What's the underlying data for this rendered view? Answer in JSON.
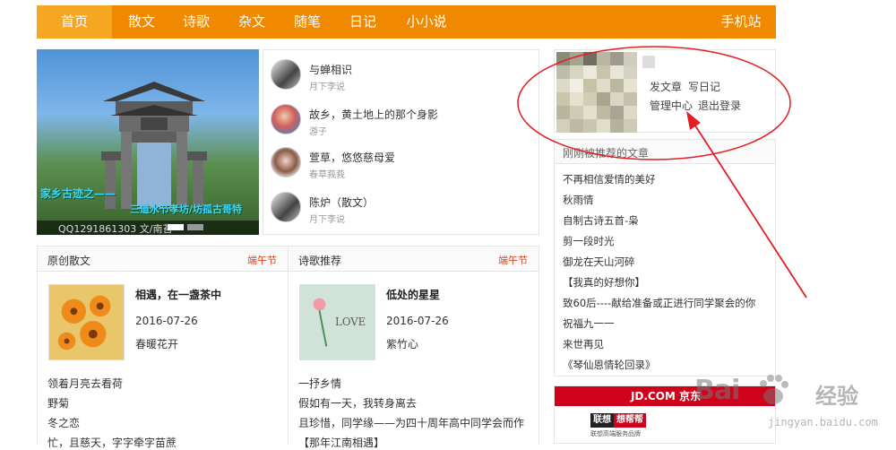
{
  "nav": {
    "items": [
      {
        "label": "首页",
        "active": true
      },
      {
        "label": "散文"
      },
      {
        "label": "诗歌"
      },
      {
        "label": "杂文"
      },
      {
        "label": "随笔"
      },
      {
        "label": "日记"
      },
      {
        "label": "小小说"
      }
    ],
    "mobile_label": "手机站",
    "color": "#f08800"
  },
  "slider": {
    "text_line1": "家乡古迹之——",
    "text_line2": "三道水节孝坊/坊孤古哥特",
    "caption": "QQ1291861303  文/南苔"
  },
  "featured": [
    {
      "title": "与蝉相识",
      "author": "月下李说"
    },
    {
      "title": "故乡，黄土地上的那个身影",
      "author": "游子"
    },
    {
      "title": "萱草，悠悠慈母爱",
      "author": "春草莪莪"
    },
    {
      "title": "陈炉（散文）",
      "author": "月下李说"
    }
  ],
  "prose": {
    "title": "原创散文",
    "tag": "端午节",
    "top": {
      "title": "相遇，在一盏茶中",
      "date": "2016-07-26",
      "author": "春暖花开"
    },
    "list": [
      "领着月亮去看荷",
      "野菊",
      "冬之恋",
      "忙，且慈天，字字牵字苗蔗"
    ]
  },
  "poetry": {
    "title": "诗歌推荐",
    "tag": "端午节",
    "top": {
      "title": "低处的星星",
      "date": "2016-07-26",
      "author": "紫竹心"
    },
    "list": [
      "一抒乡情",
      "假如有一天，我转身离去",
      "且珍惜，同学缘——为四十周年高中同学会而作",
      "【那年江南相遇】"
    ]
  },
  "user": {
    "post_article": "发文章",
    "write_diary": "写日记",
    "manage_center": "管理中心",
    "logout": "退出登录"
  },
  "recommended": {
    "title": "刚刚被推荐的文章",
    "items": [
      "不再相信爱情的美好",
      "秋雨情",
      "自制古诗五首-枭",
      "剪一段时光",
      "御龙在天山河碎",
      "【我真的好想你】",
      "致60后----献给准备或正进行同学聚会的你",
      "祝福九一一",
      "来世再见",
      "《琴仙恩情轮回录》"
    ]
  },
  "ad": {
    "header": "JD.COM 京东",
    "logo_left": "联想",
    "logo_right": "想帮帮",
    "sub": "联想高端服务品牌"
  },
  "watermark": {
    "brand": "Bai",
    "brand_cn": "经验",
    "url": "jingyan.baidu.com"
  },
  "thumb_letters": "LOVE",
  "accent": "#f08800",
  "annotation_color": "#e31e24"
}
